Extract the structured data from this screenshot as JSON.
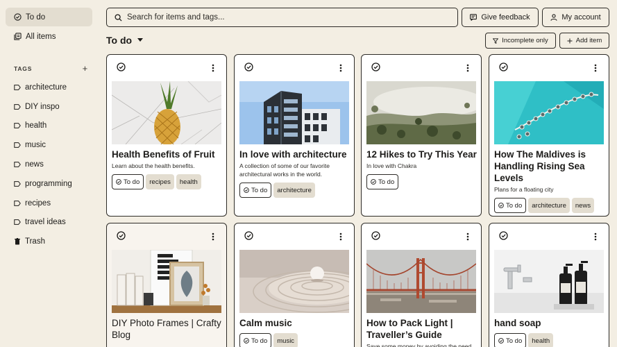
{
  "sidebar": {
    "nav": [
      {
        "label": "To do",
        "icon": "check-circle-icon"
      },
      {
        "label": "All items",
        "icon": "stack-icon"
      }
    ],
    "tags_heading": "TAGS",
    "add_tag": "+",
    "tags": [
      "architecture",
      "DIY inspo",
      "health",
      "music",
      "news",
      "programming",
      "recipes",
      "travel ideas"
    ],
    "trash_label": "Trash"
  },
  "search": {
    "placeholder": "Search for items and tags..."
  },
  "header": {
    "feedback_label": "Give feedback",
    "account_label": "My account"
  },
  "view": {
    "title": "To do",
    "incomplete_label": "Incomplete only",
    "add_label": "Add item"
  },
  "colors": {
    "background": "#f3eee3",
    "chip": "#e3ddd0",
    "border": "#2d2b27"
  },
  "cards": [
    {
      "title": "Health Benefits of Fruit",
      "desc": "Learn about the health benefits.",
      "status": "To do",
      "tags": [
        "recipes",
        "health"
      ],
      "image": "pineapple on marble"
    },
    {
      "title": "In love with architecture",
      "desc": "A collection of some of our favorite architectural works in the world.",
      "status": "To do",
      "tags": [
        "architecture"
      ],
      "image": "modern building"
    },
    {
      "title": "12 Hikes to Try This Year",
      "desc": "In love with Chakra",
      "status": "To do",
      "tags": [],
      "image": "misty forest"
    },
    {
      "title": "How The Maldives is Handling Rising Sea Levels",
      "desc": "Plans for a floating city",
      "status": "To do",
      "tags": [
        "architecture",
        "news"
      ],
      "image": "maldives aerial"
    },
    {
      "title": "DIY Photo Frames | Crafty Blog",
      "desc": "",
      "status": "",
      "tags": [],
      "image": "photo frames"
    },
    {
      "title": "Calm music",
      "desc": "",
      "status": "To do",
      "tags": [
        "music"
      ],
      "image": "water ripples"
    },
    {
      "title": "How to Pack Light | Traveller’s Guide",
      "desc": "Save some money by avoiding the need",
      "status": "",
      "tags": [],
      "image": "red bridge"
    },
    {
      "title": "hand soap",
      "desc": "",
      "status": "To do",
      "tags": [
        "health"
      ],
      "image": "soap bottles"
    }
  ]
}
